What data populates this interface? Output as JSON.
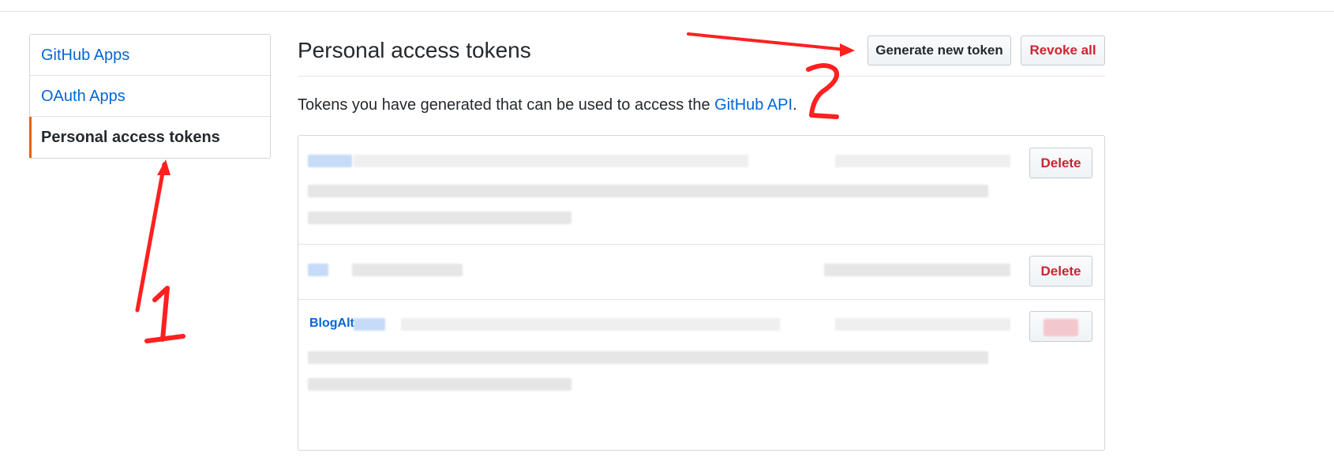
{
  "sidebar": {
    "items": [
      {
        "label": "GitHub Apps"
      },
      {
        "label": "OAuth Apps"
      },
      {
        "label": "Personal access tokens",
        "selected": true
      }
    ]
  },
  "main": {
    "title": "Personal access tokens",
    "buttons": {
      "generate": "Generate new token",
      "revoke_all": "Revoke all"
    },
    "description": {
      "prefix": "Tokens you have generated that can be used to access the ",
      "link": "GitHub API",
      "suffix": "."
    },
    "tokens": [
      {
        "delete_label": "Delete"
      },
      {
        "delete_label": "Delete"
      },
      {
        "name": "BlogAlt",
        "delete_label": "Delete"
      }
    ]
  },
  "annotations": {
    "arrow_1_label": "1",
    "arrow_2_label": "2",
    "color": "#ff2020"
  },
  "colors": {
    "link": "#0366d6",
    "danger": "#cb2431",
    "selected_marker": "#e36209"
  }
}
